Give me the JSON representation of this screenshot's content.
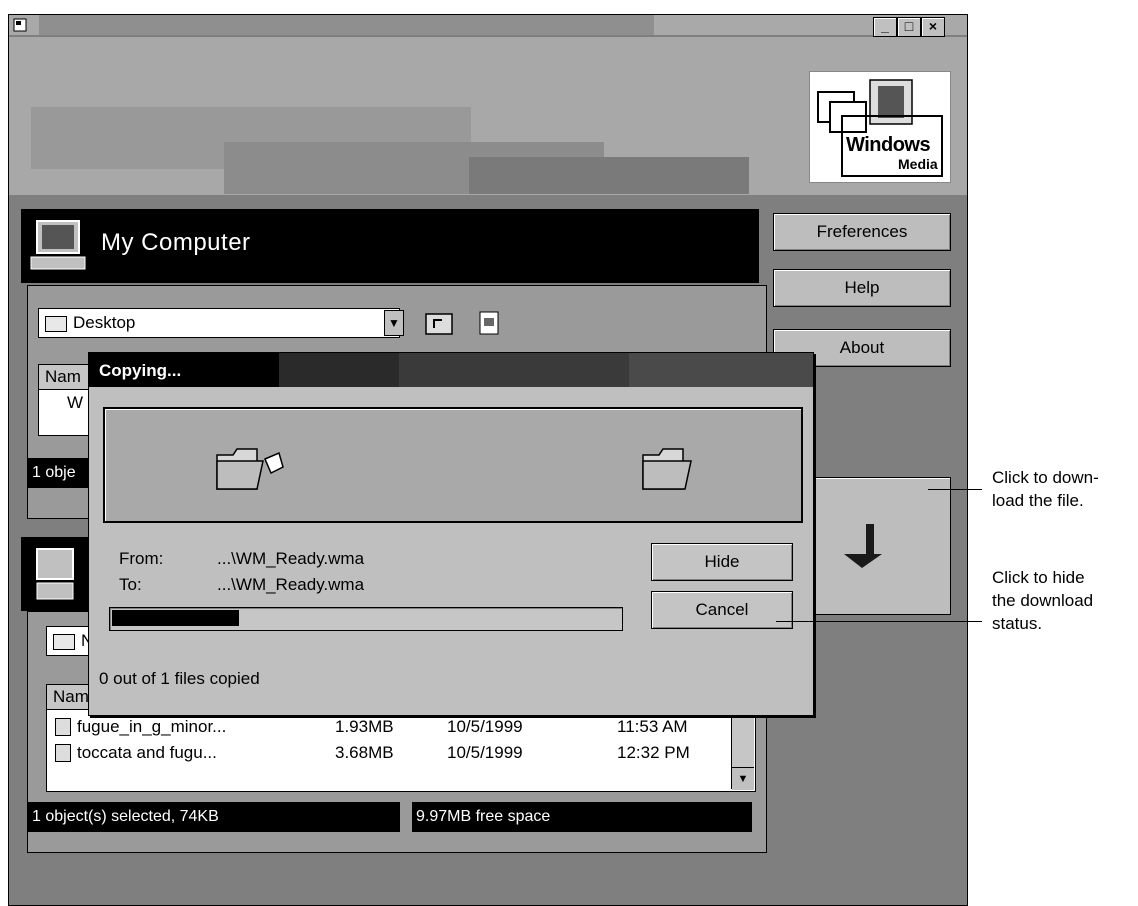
{
  "window": {
    "controls": {
      "minimize": "_",
      "maximize": "□",
      "close": "×"
    }
  },
  "logo": {
    "line1": "Windows",
    "line2": "Media"
  },
  "side_buttons": [
    "Freferences",
    "Help",
    "About"
  ],
  "my_computer": {
    "title": "My Computer",
    "folder_select": "Desktop",
    "column_header_partial": "Nam",
    "row_partial": "W",
    "status_partial": "1 obje"
  },
  "device_panel": {
    "folder_select_partial": "N",
    "column_header_partial": "Nam",
    "files": [
      {
        "name": "fugue_in_g_minor...",
        "size": "1.93MB",
        "date": "10/5/1999",
        "time": "11:53 AM"
      },
      {
        "name": "toccata and fugu...",
        "size": "3.68MB",
        "date": "10/5/1999",
        "time": "12:32 PM"
      }
    ],
    "status_selected": "1 object(s) selected, 74KB",
    "status_free": "9.97MB free space"
  },
  "copy_dialog": {
    "title": "Copying...",
    "from_label": "From:",
    "from_value": "...\\WM_Ready.wma",
    "to_label": "To:",
    "to_value": "...\\WM_Ready.wma",
    "progress": 0.25,
    "status": "0 out of 1 files copied",
    "hide_button": "Hide",
    "cancel_button": "Cancel"
  },
  "annotations": {
    "download": [
      "Click to down-",
      "load the file."
    ],
    "hide": [
      "Click to hide",
      "the download",
      "status."
    ]
  },
  "colors": {
    "titlebar": "#a9a9a9",
    "panel": "#7f7f7f",
    "black": "#000000"
  },
  "icons": [
    "computer-icon",
    "folder-icon",
    "up-folder-icon",
    "media-file-icon",
    "download-arrow-icon",
    "portable-device-icon"
  ]
}
